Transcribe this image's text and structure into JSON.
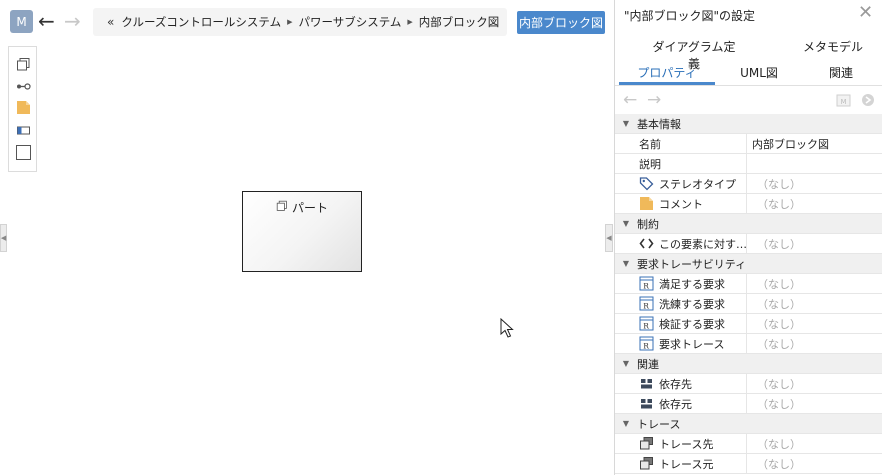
{
  "header": {
    "model_badge": "M",
    "back_icon": "←",
    "forward_icon": "→",
    "breadcrumb_lead": "«",
    "breadcrumb": [
      "クルーズコントロールシステム",
      "パワーサブシステム",
      "内部ブロック図"
    ],
    "diagram_title_button": "内部ブロック図"
  },
  "palette": {
    "items": [
      "part-icon",
      "connector-icon",
      "comment-icon",
      "flow-port-icon",
      "boundary-icon"
    ]
  },
  "canvas": {
    "part_label": "パート"
  },
  "panel": {
    "title": "\"内部ブロック図\"の設定",
    "close_icon": "✕",
    "tabs_row1": [
      "ダイアグラム定義",
      "メタモデル"
    ],
    "tabs_row2": [
      "プロパティ",
      "UML図",
      "関連"
    ],
    "active_tab": "プロパティ",
    "sections": [
      {
        "title": "基本情報",
        "rows": [
          {
            "name": "名前",
            "value": "内部ブロック図",
            "icon": ""
          },
          {
            "name": "説明",
            "value": "",
            "icon": ""
          },
          {
            "name": "ステレオタイプ",
            "value": "（なし）",
            "icon": "tag-icon"
          },
          {
            "name": "コメント",
            "value": "（なし）",
            "icon": "comment-icon"
          }
        ]
      },
      {
        "title": "制約",
        "rows": [
          {
            "name": "この要素に対す…",
            "value": "（なし）",
            "icon": "code-icon"
          }
        ]
      },
      {
        "title": "要求トレーサビリティ",
        "rows": [
          {
            "name": "満足する要求",
            "value": "（なし）",
            "icon": "requirement-icon"
          },
          {
            "name": "洗練する要求",
            "value": "（なし）",
            "icon": "requirement-icon"
          },
          {
            "name": "検証する要求",
            "value": "（なし）",
            "icon": "requirement-icon"
          },
          {
            "name": "要求トレース",
            "value": "（なし）",
            "icon": "requirement-icon"
          }
        ]
      },
      {
        "title": "関連",
        "rows": [
          {
            "name": "依存先",
            "value": "（なし）",
            "icon": "dependency-icon"
          },
          {
            "name": "依存元",
            "value": "（なし）",
            "icon": "dependency-icon"
          }
        ]
      },
      {
        "title": "トレース",
        "rows": [
          {
            "name": "トレース先",
            "value": "（なし）",
            "icon": "trace-icon"
          },
          {
            "name": "トレース元",
            "value": "（なし）",
            "icon": "trace-icon"
          }
        ]
      }
    ]
  },
  "colors": {
    "accent": "#4a88cc",
    "badge": "#8da4c1",
    "comment": "#f0b95a"
  }
}
